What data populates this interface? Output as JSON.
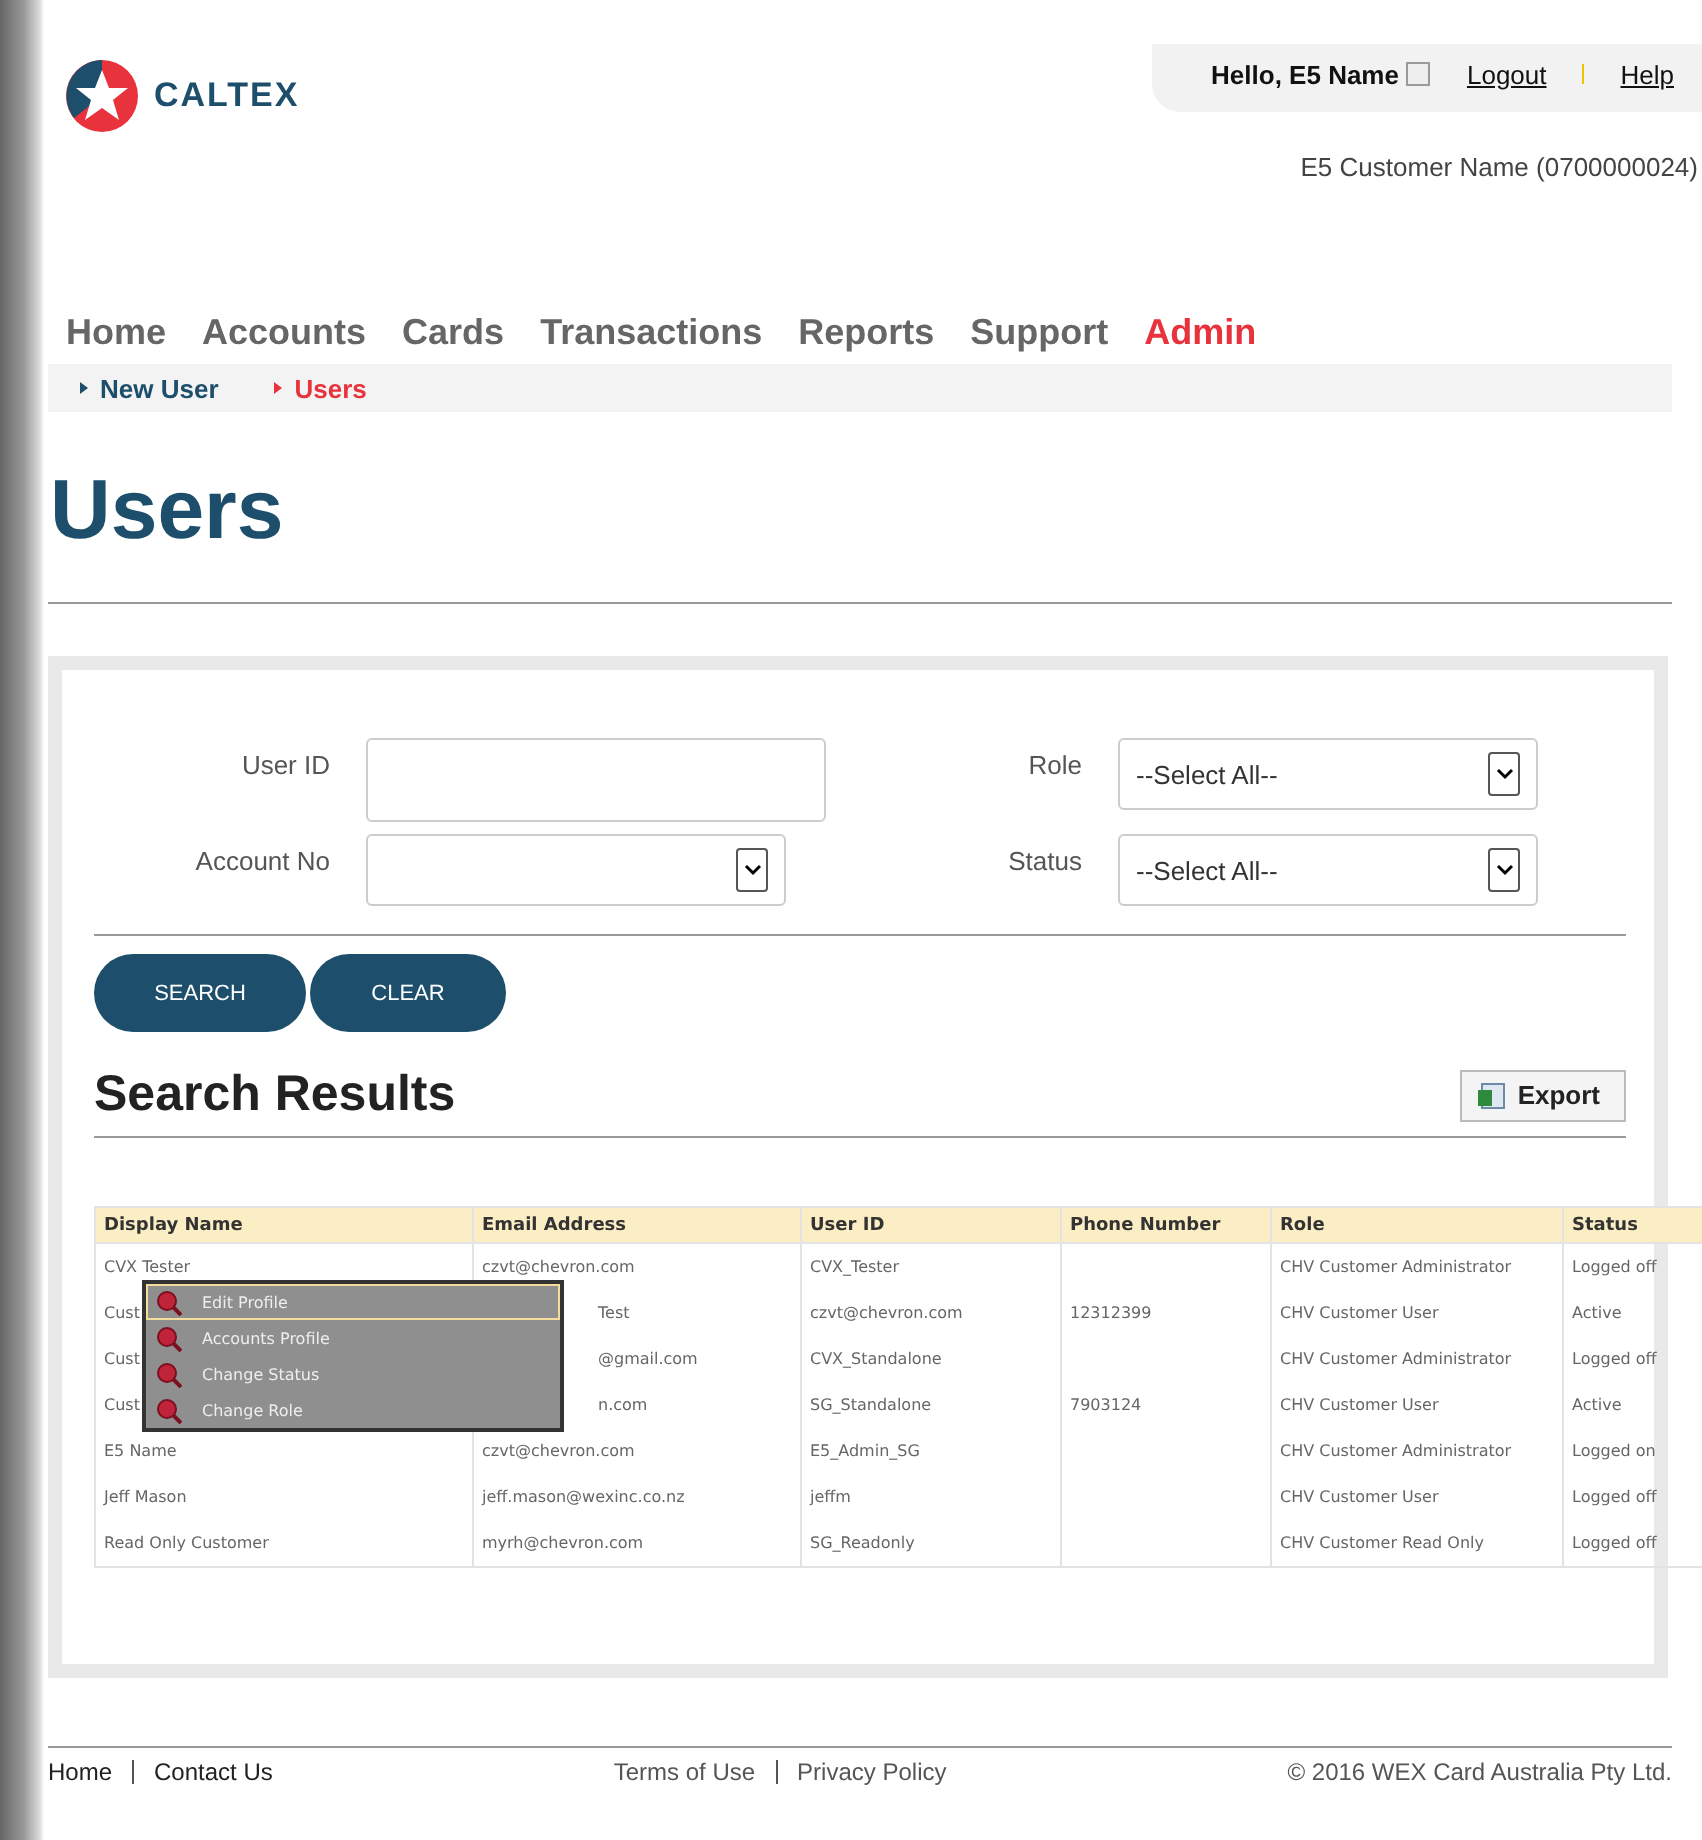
{
  "header": {
    "brand": "CALTEX",
    "greeting": "Hello, E5 Name",
    "links": [
      "Logout",
      "Help"
    ],
    "customer": "E5 Customer Name (0700000024)"
  },
  "nav": [
    {
      "label": "Home",
      "selected": false
    },
    {
      "label": "Accounts",
      "selected": false
    },
    {
      "label": "Cards",
      "selected": false
    },
    {
      "label": "Transactions",
      "selected": false
    },
    {
      "label": "Reports",
      "selected": false
    },
    {
      "label": "Support",
      "selected": false
    },
    {
      "label": "Admin",
      "selected": true
    }
  ],
  "subnav": [
    {
      "label": "New User",
      "selected": false
    },
    {
      "label": "Users",
      "selected": true
    }
  ],
  "title": "Users",
  "form": {
    "fields": [
      {
        "label": "User ID",
        "kind": "text"
      },
      {
        "label": "Role",
        "kind": "select",
        "value": "--Select All--"
      },
      {
        "label": "Account No",
        "kind": "select"
      },
      {
        "label": "Status",
        "kind": "select",
        "value": "--Select All--"
      }
    ],
    "buttons": [
      "SEARCH",
      "CLEAR"
    ]
  },
  "results": {
    "title": "Search Results",
    "export": "Export",
    "columns": [
      "Display Name",
      "Email Address",
      "User ID",
      "Phone Number",
      "Role",
      "Status"
    ],
    "rows": [
      [
        "CVX Tester",
        "czvt@chevron.com",
        "CVX_Tester",
        "",
        "CHV Customer Administrator",
        "Logged off"
      ],
      [
        "Cust",
        "Test",
        "czvt@chevron.com",
        "12312399",
        "CHV Customer User",
        "Active"
      ],
      [
        "Cust",
        "@gmail.com",
        "CVX_Standalone",
        "",
        "CHV Customer Administrator",
        "Logged off"
      ],
      [
        "Cust",
        "n.com",
        "SG_Standalone",
        "7903124",
        "CHV Customer User",
        "Active"
      ],
      [
        "E5 Name",
        "czvt@chevron.com",
        "E5_Admin_SG",
        "",
        "CHV Customer Administrator",
        "Logged on"
      ],
      [
        "Jeff Mason",
        "jeff.mason@wexinc.co.nz",
        "jeffm",
        "",
        "CHV Customer User",
        "Logged off"
      ],
      [
        "Read Only Customer",
        "myrh@chevron.com",
        "SG_Readonly",
        "",
        "CHV Customer Read Only",
        "Logged off"
      ]
    ],
    "context_menu": [
      {
        "label": "Edit Profile",
        "selected": true
      },
      {
        "label": "Accounts Profile",
        "selected": false
      },
      {
        "label": "Change Status",
        "selected": false
      },
      {
        "label": "Change Role",
        "selected": false
      }
    ]
  },
  "footer": {
    "left": [
      "Home",
      "Contact Us"
    ],
    "middle": [
      "Terms of Use",
      "Privacy Policy"
    ],
    "copyright": "©  2016 WEX Card Australia Pty Ltd."
  }
}
